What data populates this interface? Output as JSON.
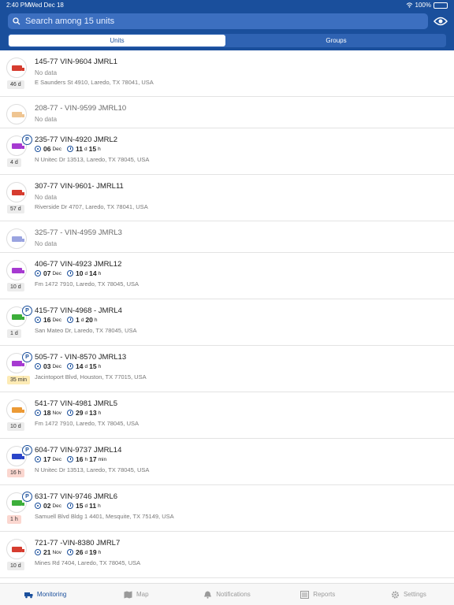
{
  "status_bar": {
    "time": "2:40 PM",
    "date": "Wed Dec 18",
    "battery": "100%"
  },
  "header": {
    "search_placeholder": "Search among 15 units",
    "icons": {
      "search": "search-icon",
      "visibility": "eye-icon"
    },
    "segments": [
      "Units",
      "Groups"
    ],
    "active_segment": "Units"
  },
  "units": [
    {
      "name": "145-77 VIN-9604  JMRL1",
      "truck_color": "#d63c2f",
      "parked": false,
      "age": "46 d",
      "age_style": "gray",
      "no_data": "No data",
      "address": "E Saunders St 4910, Laredo, TX 78041, USA"
    },
    {
      "name": "208-77 - VIN-9599 JMRL10",
      "truck_color": "#efc592",
      "parked": false,
      "dim": true,
      "no_data": "No data"
    },
    {
      "name": "235-77 VIN-4920 JMRL2",
      "truck_color": "#a63ad1",
      "parked": true,
      "age": "4 d",
      "age_style": "gray",
      "date_day": "06",
      "date_month": "Dec",
      "dur_a": "11",
      "dur_a_unit": "d",
      "dur_b": "15",
      "dur_b_unit": "h",
      "address": "N Unitec Dr 13513, Laredo, TX 78045, USA"
    },
    {
      "name": "307-77 VIN-9601- JMRL11",
      "truck_color": "#d63c2f",
      "parked": false,
      "age": "57 d",
      "age_style": "gray",
      "no_data": "No data",
      "address": "Riverside Dr 4707, Laredo, TX 78041, USA"
    },
    {
      "name": "325-77 - VIN-4959 JMRL3",
      "truck_color": "#9aa4e0",
      "parked": false,
      "dim": true,
      "no_data": "No data"
    },
    {
      "name": "406-77 VIN-4923 JMRL12",
      "truck_color": "#a63ad1",
      "parked": false,
      "age": "10 d",
      "age_style": "gray",
      "date_day": "07",
      "date_month": "Dec",
      "dur_a": "10",
      "dur_a_unit": "d",
      "dur_b": "14",
      "dur_b_unit": "h",
      "address": "Fm 1472 7910, Laredo, TX 78045, USA"
    },
    {
      "name": "415-77 VIN-4968 - JMRL4",
      "truck_color": "#3cae3a",
      "parked": true,
      "age": "1 d",
      "age_style": "gray",
      "date_day": "16",
      "date_month": "Dec",
      "dur_a": "1",
      "dur_a_unit": "d",
      "dur_b": "20",
      "dur_b_unit": "h",
      "address": "San Mateo Dr, Laredo, TX 78045, USA"
    },
    {
      "name": "505-77 - VIN-8570 JMRL13",
      "truck_color": "#a63ad1",
      "parked": true,
      "age": "35 min",
      "age_style": "orange",
      "date_day": "03",
      "date_month": "Dec",
      "dur_a": "14",
      "dur_a_unit": "d",
      "dur_b": "15",
      "dur_b_unit": "h",
      "address": "Jacintoport Blvd, Houston, TX 77015, USA"
    },
    {
      "name": "541-77 VIN-4981 JMRL5",
      "truck_color": "#ec9a35",
      "parked": false,
      "age": "10 d",
      "age_style": "gray",
      "date_day": "18",
      "date_month": "Nov",
      "dur_a": "29",
      "dur_a_unit": "d",
      "dur_b": "13",
      "dur_b_unit": "h",
      "address": "Fm 1472 7910, Laredo, TX 78045, USA"
    },
    {
      "name": "604-77 VIN-9737 JMRL14",
      "truck_color": "#2a45c9",
      "parked": true,
      "age": "16 h",
      "age_style": "red",
      "date_day": "17",
      "date_month": "Dec",
      "dur_a": "16",
      "dur_a_unit": "h",
      "dur_b": "17",
      "dur_b_unit": "min",
      "address": "N Unitec Dr 13513, Laredo, TX 78045, USA"
    },
    {
      "name": "631-77 VIN-9746 JMRL6",
      "truck_color": "#3cae3a",
      "parked": true,
      "age": "1 h",
      "age_style": "red",
      "date_day": "02",
      "date_month": "Dec",
      "dur_a": "15",
      "dur_a_unit": "d",
      "dur_b": "11",
      "dur_b_unit": "h",
      "address": "Samuell Blvd Bldg 1 4401, Mesquite, TX 75149, USA"
    },
    {
      "name": "721-77 -VIN-8380 JMRL7",
      "truck_color": "#d63c2f",
      "parked": false,
      "age": "10 d",
      "age_style": "gray",
      "date_day": "21",
      "date_month": "Nov",
      "dur_a": "26",
      "dur_a_unit": "d",
      "dur_b": "19",
      "dur_b_unit": "h",
      "address": "Mines Rd 7404, Laredo, TX 78045, USA"
    }
  ],
  "tabbar": {
    "tabs": [
      {
        "label": "Monitoring",
        "icon": "truck-icon",
        "active": true
      },
      {
        "label": "Map",
        "icon": "map-icon",
        "active": false
      },
      {
        "label": "Notifications",
        "icon": "bell-icon",
        "active": false
      },
      {
        "label": "Reports",
        "icon": "reports-icon",
        "active": false
      },
      {
        "label": "Settings",
        "icon": "gear-icon",
        "active": false
      }
    ]
  },
  "colors": {
    "brand": "#1a4f9c",
    "search_bg": "#3c6fc0",
    "age_warning": "#fdebb5",
    "age_alert": "#fbd7d0"
  }
}
